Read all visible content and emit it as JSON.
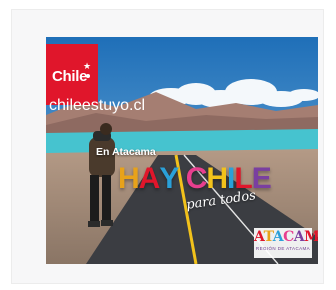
{
  "ad": {
    "brand_word": "Chile",
    "brand_url": "chileestuyo.cl",
    "headline": "En Atacama",
    "main_letters": [
      {
        "ch": "H",
        "color": "#e8a21a"
      },
      {
        "ch": "A",
        "color": "#e0162b"
      },
      {
        "ch": "Y",
        "color": "#2aa0d8"
      },
      {
        "ch": " ",
        "color": "#ffffff"
      },
      {
        "ch": "C",
        "color": "#e73f8f"
      },
      {
        "ch": "H",
        "color": "#f2c21b"
      },
      {
        "ch": "I",
        "color": "#2aa0d8"
      },
      {
        "ch": "L",
        "color": "#e0162b"
      },
      {
        "ch": "E",
        "color": "#7a3fa0"
      }
    ],
    "tagline": "para todos",
    "region_logo": "ATACAMA",
    "region_sub": "REGIÓN DE ATACAMA"
  },
  "colors": {
    "sky": "#2e7fc4",
    "lagoon": "#46c3cf",
    "road": "#3b3d42",
    "road_line": "#f2c21b",
    "brand_red": "#e0162b"
  }
}
